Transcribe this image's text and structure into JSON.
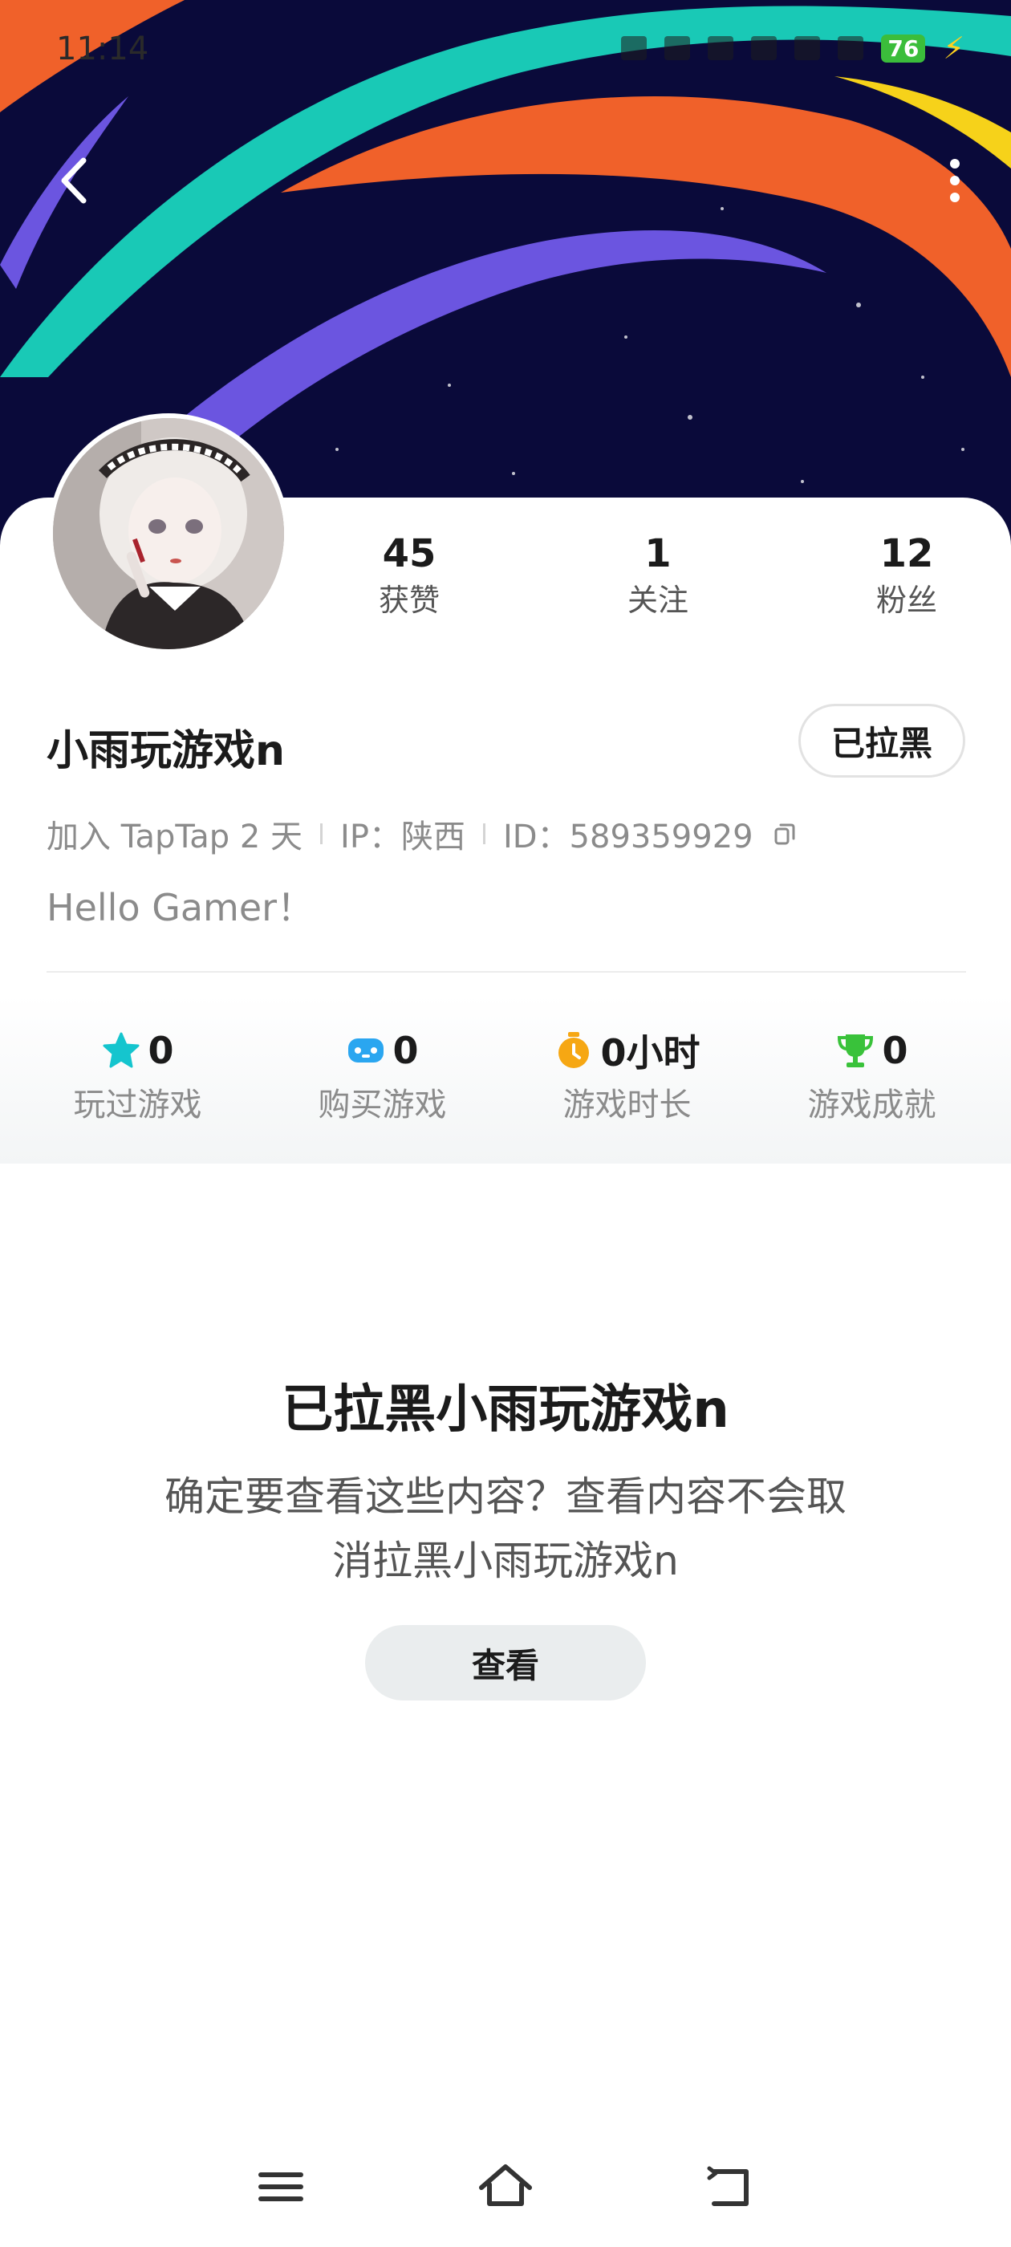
{
  "status_bar": {
    "time": "11:14",
    "battery": "76",
    "icons": [
      "alarm-icon",
      "mute-icon",
      "nfc-icon",
      "signal-4g-icon",
      "signal-5g-icon",
      "wifi-icon",
      "battery-icon",
      "charging-icon"
    ]
  },
  "header": {
    "back_icon": "chevron-left-icon",
    "more_icon": "more-vertical-icon",
    "colors": {
      "sky": "#0a0a3a",
      "teal": "#19c9b6",
      "orange": "#f0612a",
      "purple": "#6b55e0",
      "yellow": "#f6d21a"
    }
  },
  "profile": {
    "stats": [
      {
        "value": "45",
        "label": "获赞"
      },
      {
        "value": "1",
        "label": "关注"
      },
      {
        "value": "12",
        "label": "粉丝"
      }
    ],
    "username": "小雨玩游戏n",
    "blocked_button": "已拉黑",
    "meta": {
      "joined": "加入 TapTap 2 天",
      "ip": "IP：陕西",
      "id": "ID：589359929"
    },
    "bio": "Hello Gamer！"
  },
  "game_stats": [
    {
      "icon": "star-icon",
      "color": "#15c5ce",
      "value": "0",
      "label": "玩过游戏"
    },
    {
      "icon": "gamepad-icon",
      "color": "#2aa6f0",
      "value": "0",
      "label": "购买游戏"
    },
    {
      "icon": "timer-icon",
      "color": "#f6a713",
      "value": "0小时",
      "label": "游戏时长"
    },
    {
      "icon": "trophy-icon",
      "color": "#39c23a",
      "value": "0",
      "label": "游戏成就"
    }
  ],
  "blocked_notice": {
    "title": "已拉黑小雨玩游戏n",
    "message_line1": "确定要查看这些内容？查看内容不会取",
    "message_line2": "消拉黑小雨玩游戏n",
    "view_button": "查看"
  },
  "nav_bar": {
    "icons": [
      "menu-icon",
      "home-icon",
      "back-icon"
    ]
  }
}
